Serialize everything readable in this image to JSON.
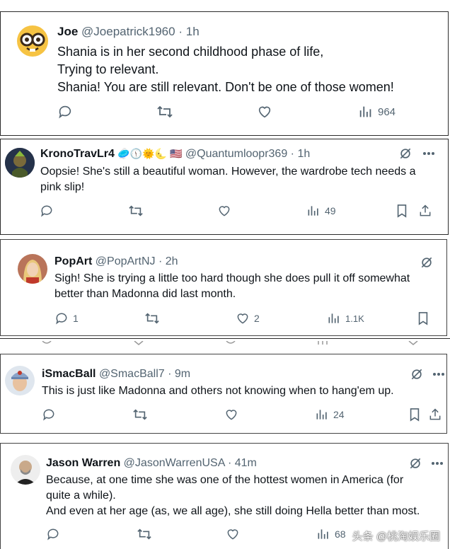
{
  "tweets": [
    {
      "name": "Joe",
      "handle": "@Joepatrick1960",
      "time": "1h",
      "lines": [
        "Shania is in her second childhood phase of life,",
        "Trying to relevant.",
        "Shania! You are still relevant. Don't be one of those women!"
      ],
      "views": "964"
    },
    {
      "name": "KronoTravLr4",
      "name_emoji": "🥏🕦🌞🌜 🇺🇸",
      "handle": "@Quantumloopr369",
      "time": "1h",
      "lines": [
        "Oopsie! She's still a beautiful woman. However, the wardrobe tech needs a",
        "pink slip!"
      ],
      "views": "49"
    },
    {
      "name": "PopArt",
      "handle": "@PopArtNJ",
      "time": "2h",
      "lines": [
        "Sigh! She is trying a little too hard though she does pull it off somewhat",
        "better than Madonna did last month."
      ],
      "replies": "1",
      "likes": "2",
      "views": "1.1K"
    },
    {
      "name": "iSmacBall",
      "handle": "@SmacBall7",
      "time": "9m",
      "lines": [
        "This is just like Madonna and others not knowing when to hang'em up."
      ],
      "views": "24"
    },
    {
      "name": "Jason Warren",
      "handle": "@JasonWarrenUSA",
      "time": "41m",
      "lines": [
        "Because, at one time she was one of the hottest women in America (for",
        "quite a while).",
        "And even at her age (as, we all age), she still doing Hella better than most."
      ],
      "views": "68"
    }
  ],
  "separator": "·",
  "watermark": "头条 @桃淘娱乐圈",
  "colors": {
    "text": "#0f1419",
    "muted": "#536471"
  }
}
